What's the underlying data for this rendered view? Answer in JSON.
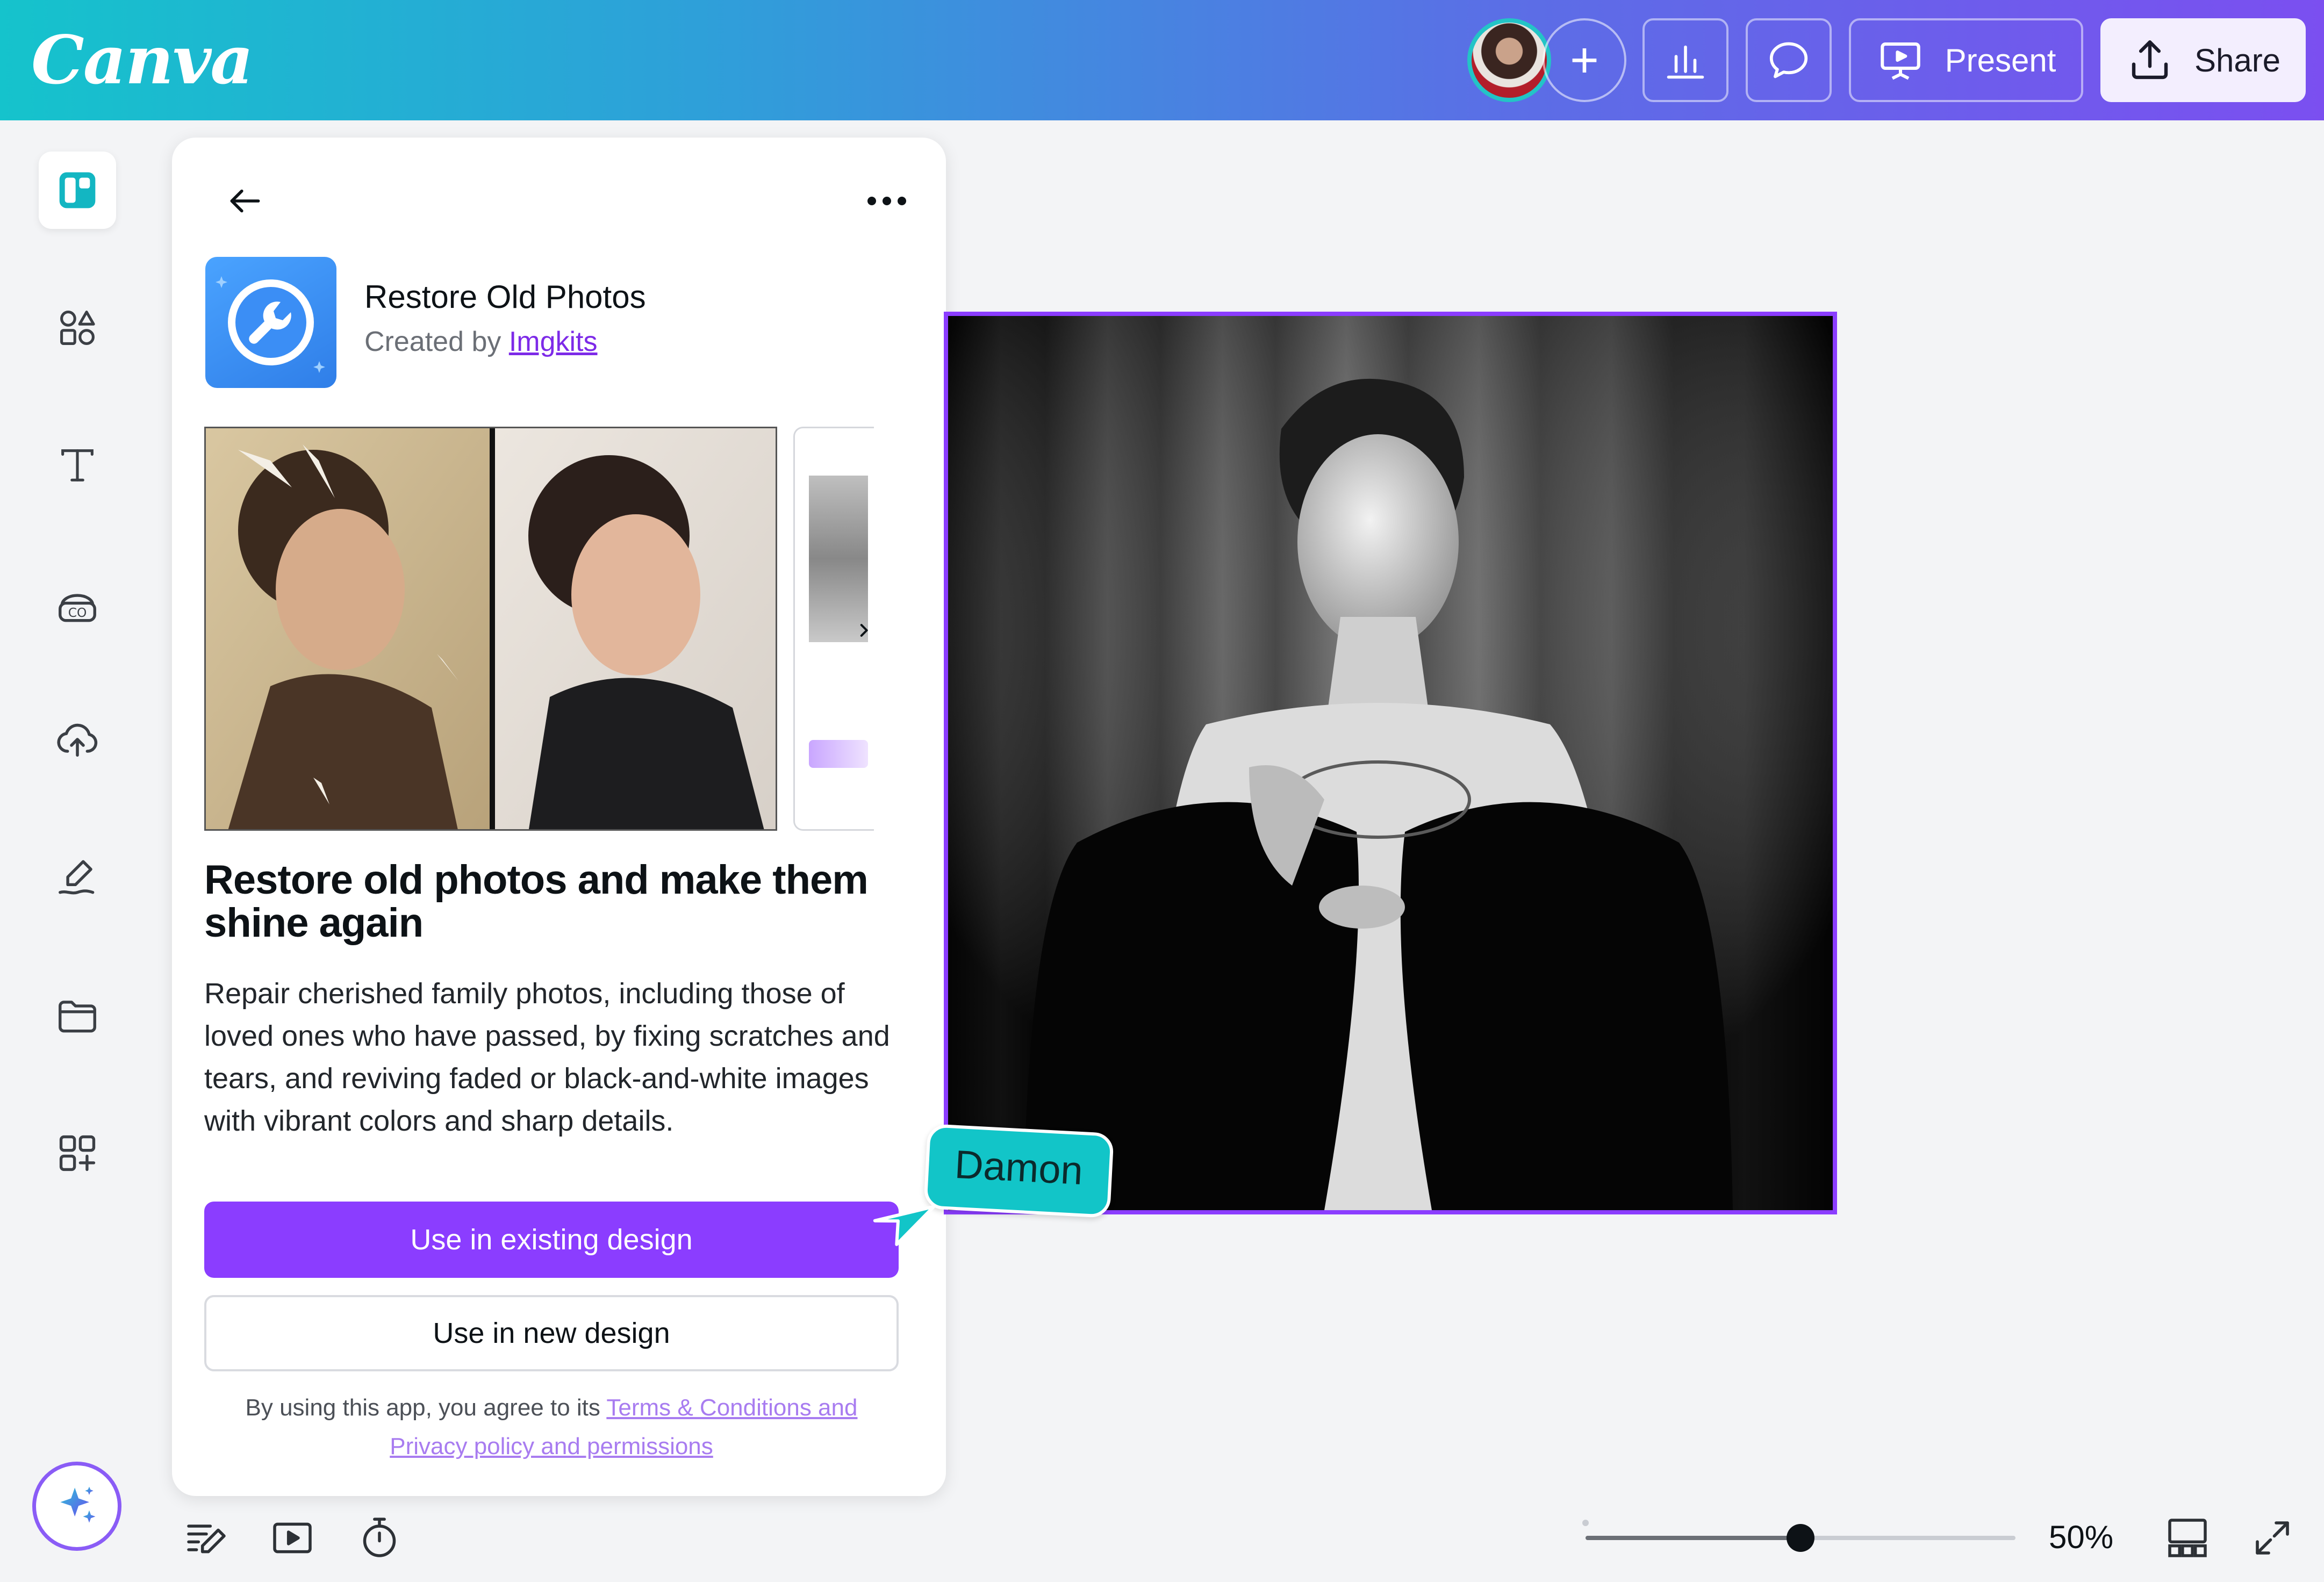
{
  "brand": {
    "logo": "Canva"
  },
  "header": {
    "present_label": "Present",
    "share_label": "Share"
  },
  "app": {
    "name": "Restore Old Photos",
    "created_by_prefix": "Created by ",
    "creator": "Imgkits",
    "heading": "Restore old photos and make them shine again",
    "description": "Repair cherished family photos, including those of loved ones who have passed, by fixing scratches and tears, and reviving faded or black-and-white images with vibrant colors and sharp details.",
    "primary_button": "Use in existing design",
    "secondary_button": "Use in new design",
    "terms_prefix": "By using this app, you agree to its ",
    "terms_link": "Terms & Conditions and Privacy policy and permissions"
  },
  "collaborator": {
    "name": "Damon"
  },
  "zoom": {
    "label": "50%",
    "value": 0.5
  },
  "colors": {
    "accent": "#8b3dff",
    "cursor": "#12c5c8"
  }
}
